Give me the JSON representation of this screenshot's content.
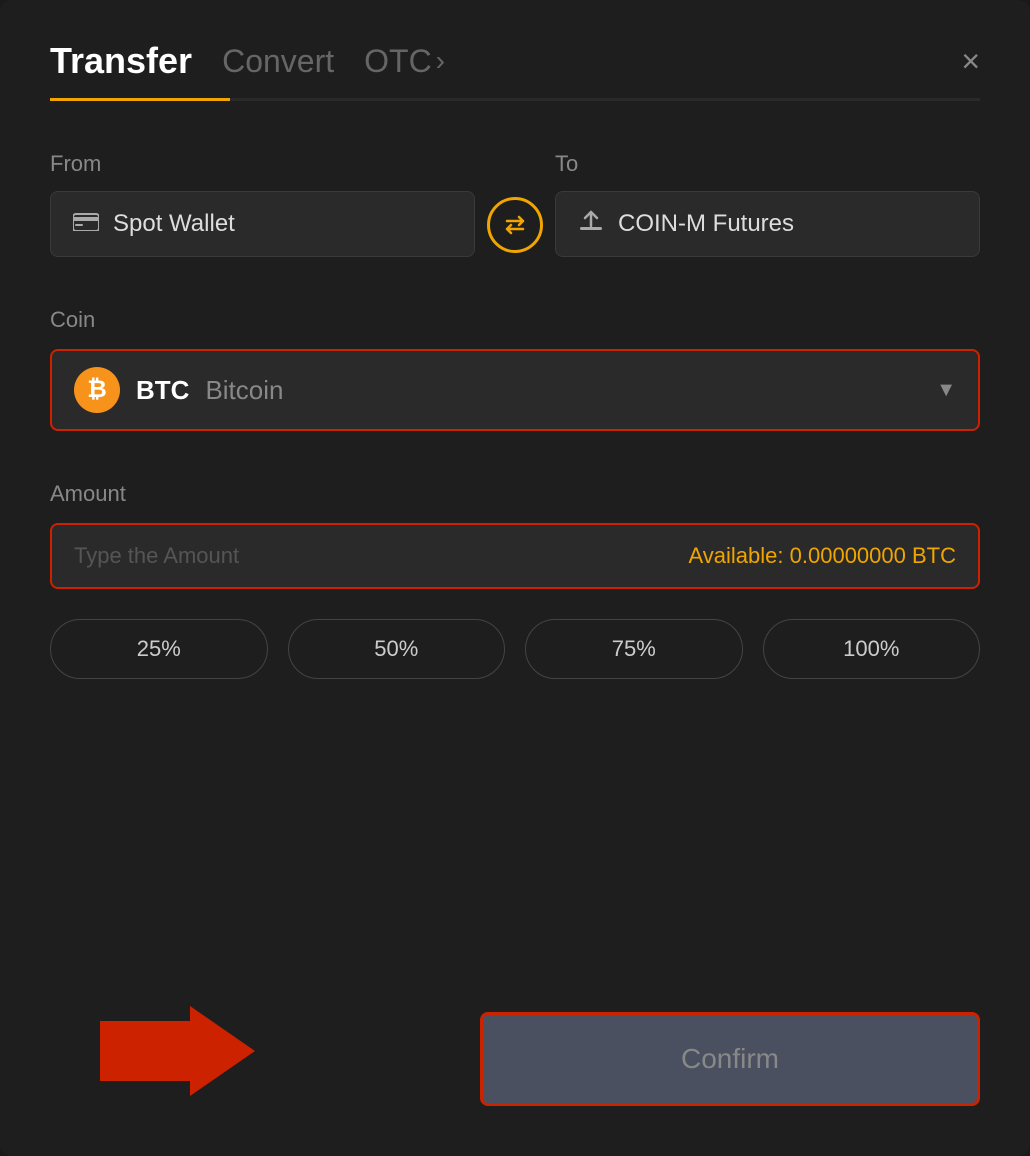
{
  "header": {
    "tab_transfer": "Transfer",
    "tab_convert": "Convert",
    "tab_otc": "OTC",
    "tab_otc_chevron": "›",
    "close_label": "×"
  },
  "from_section": {
    "label": "From",
    "wallet_name": "Spot Wallet",
    "wallet_icon": "🪪"
  },
  "to_section": {
    "label": "To",
    "wallet_name": "COIN-M Futures",
    "wallet_icon": "↑"
  },
  "swap": {
    "icon": "⇄"
  },
  "coin": {
    "label": "Coin",
    "symbol": "BTC",
    "name": "Bitcoin",
    "icon_letter": "₿"
  },
  "amount": {
    "label": "Amount",
    "placeholder": "Type the Amount",
    "available_label": "Available:",
    "available_value": "0.00000000",
    "available_currency": "BTC"
  },
  "percent_buttons": [
    {
      "label": "25%"
    },
    {
      "label": "50%"
    },
    {
      "label": "75%"
    },
    {
      "label": "100%"
    }
  ],
  "confirm": {
    "label": "Confirm"
  }
}
